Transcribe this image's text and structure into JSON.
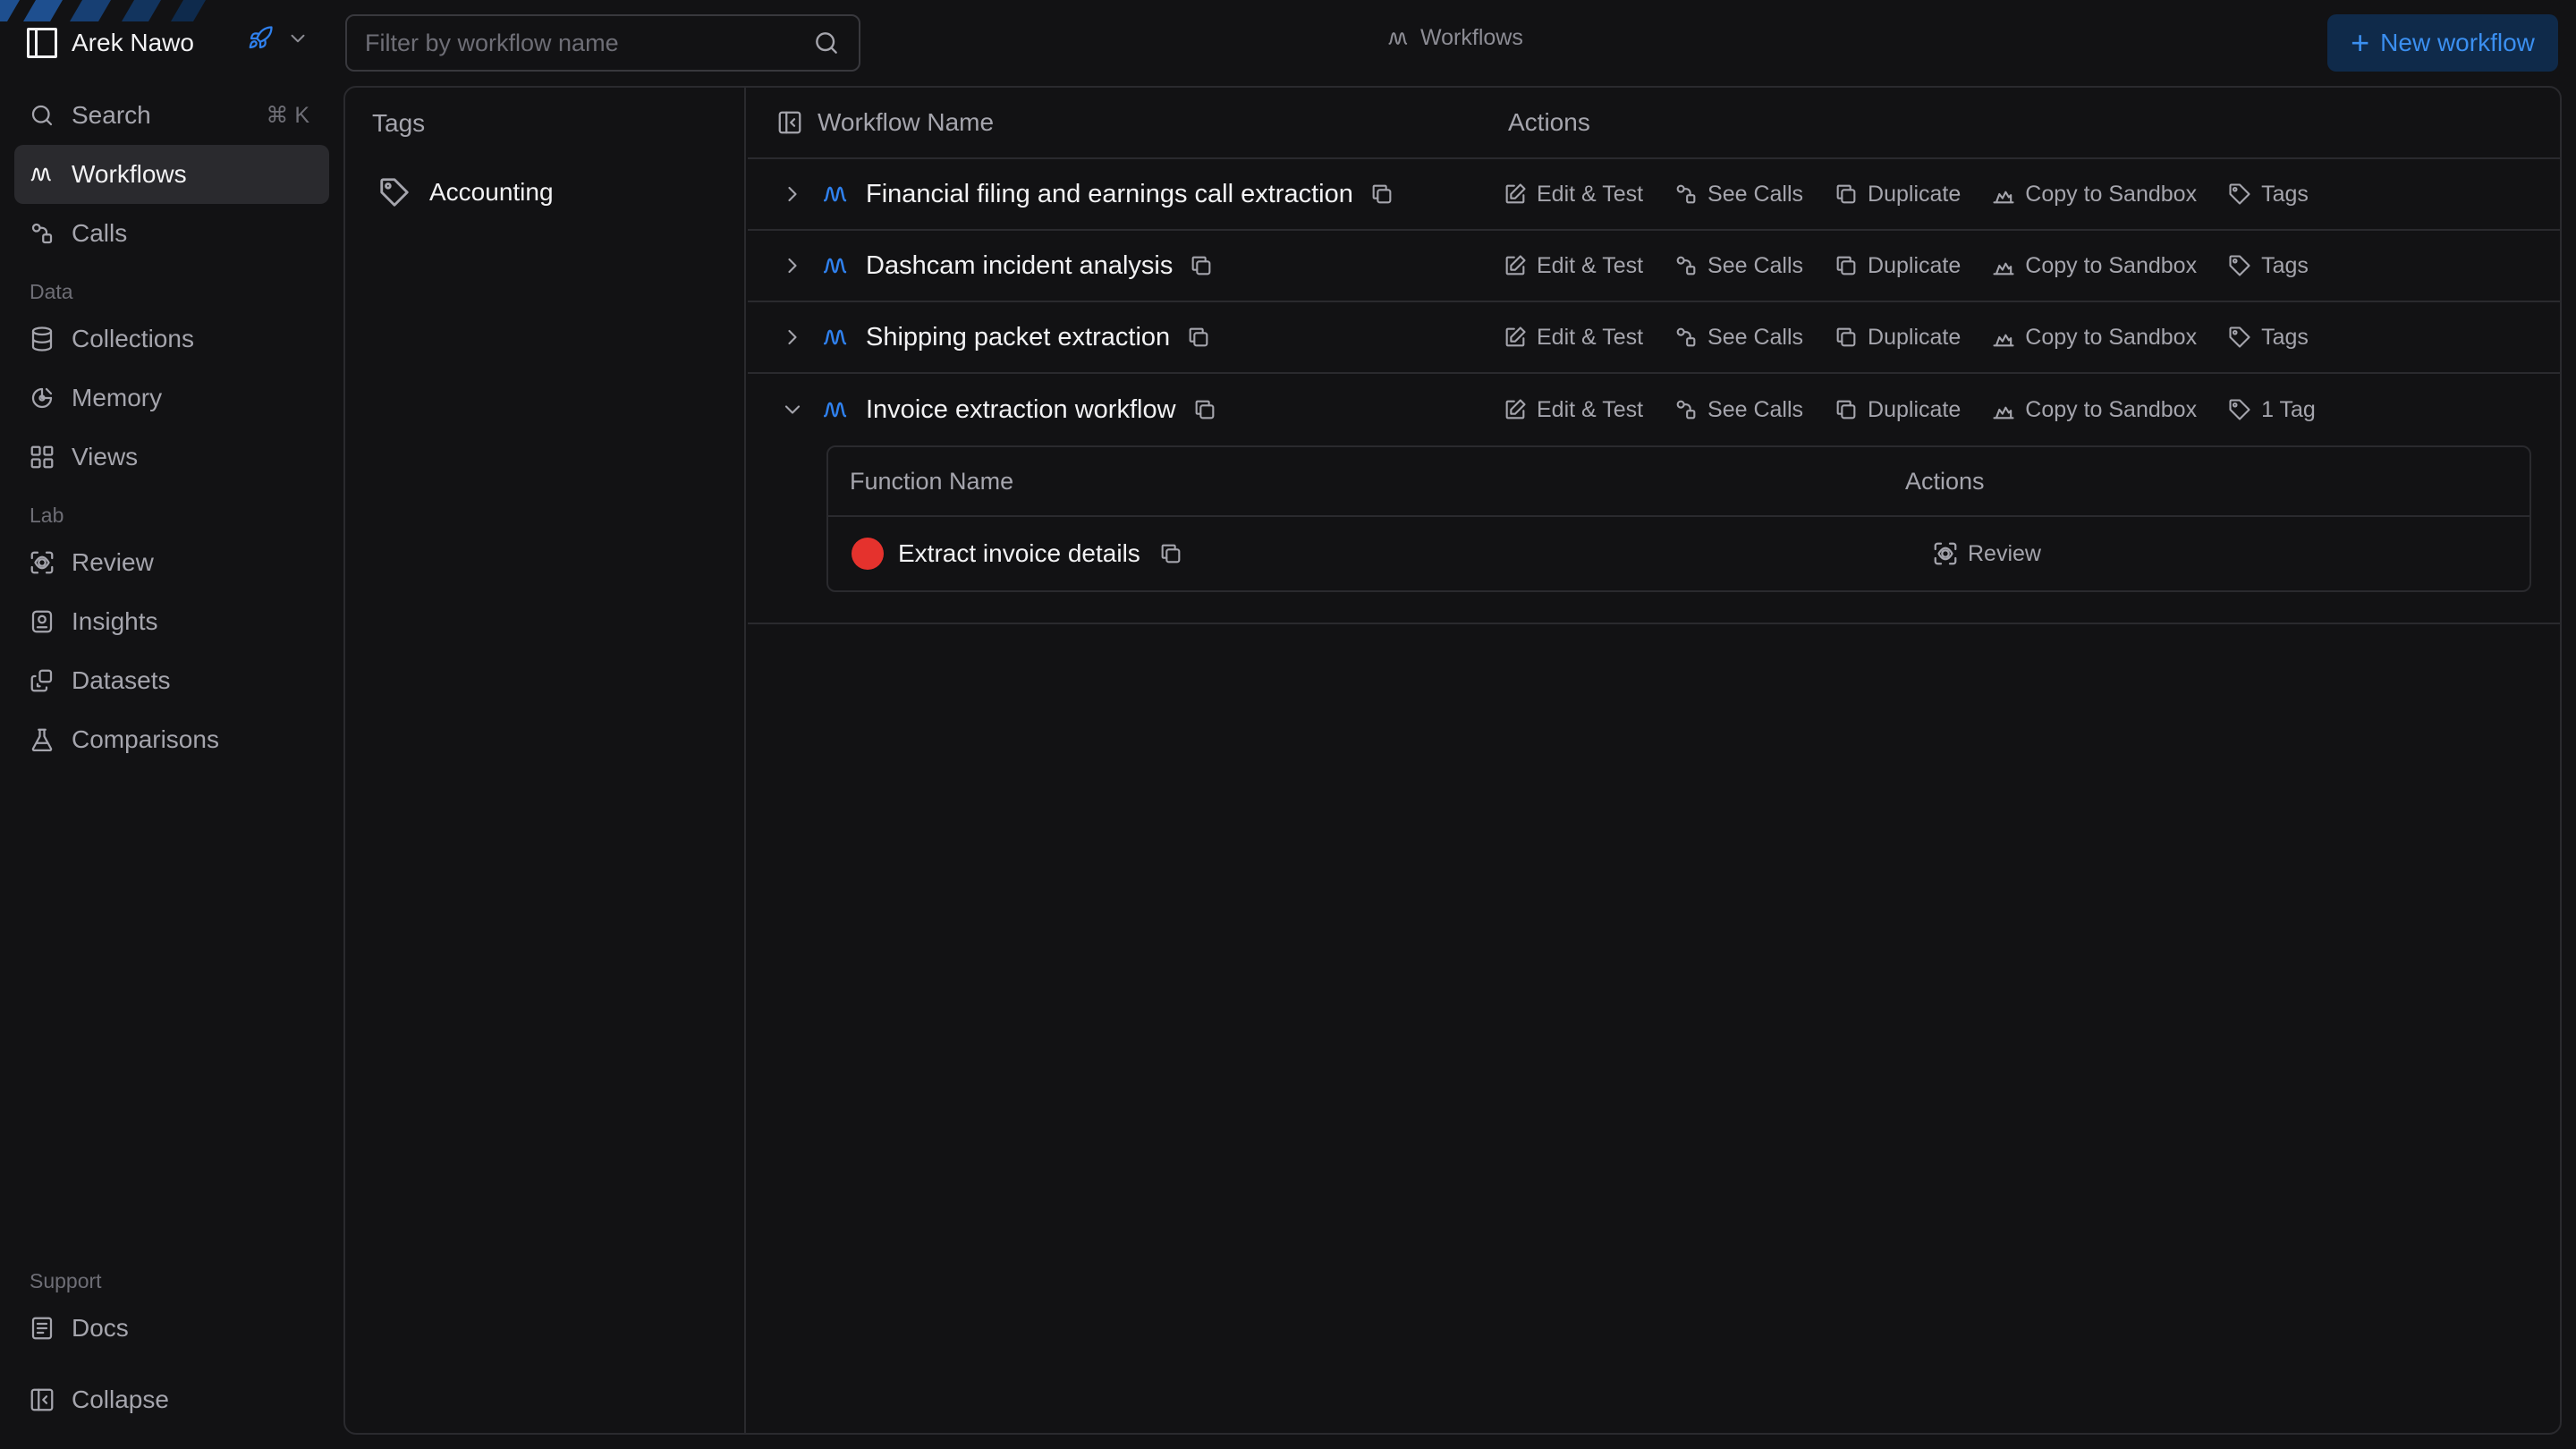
{
  "org": {
    "name": "Arek Nawo"
  },
  "sidebar": {
    "search": {
      "label": "Search",
      "shortcut": "⌘ K"
    },
    "items_top": [
      {
        "label": "Workflows",
        "icon": "workflow-icon",
        "active": true
      },
      {
        "label": "Calls",
        "icon": "calls-icon"
      }
    ],
    "section_data": "Data",
    "items_data": [
      {
        "label": "Collections",
        "icon": "database-icon"
      },
      {
        "label": "Memory",
        "icon": "memory-icon"
      },
      {
        "label": "Views",
        "icon": "grid-icon"
      }
    ],
    "section_lab": "Lab",
    "items_lab": [
      {
        "label": "Review",
        "icon": "review-icon"
      },
      {
        "label": "Insights",
        "icon": "insights-icon"
      },
      {
        "label": "Datasets",
        "icon": "datasets-icon"
      },
      {
        "label": "Comparisons",
        "icon": "flask-icon"
      }
    ],
    "section_support": "Support",
    "docs": "Docs",
    "collapse": "Collapse"
  },
  "topbar": {
    "search_placeholder": "Filter by workflow name",
    "breadcrumb": "Workflows",
    "new_workflow": "New workflow"
  },
  "tags_panel": {
    "title": "Tags",
    "items": [
      "Accounting"
    ]
  },
  "table": {
    "col_name": "Workflow Name",
    "col_actions": "Actions",
    "action_labels": {
      "edit": "Edit & Test",
      "calls": "See Calls",
      "duplicate": "Duplicate",
      "sandbox": "Copy to Sandbox"
    },
    "rows": [
      {
        "name": "Financial filing and earnings call extraction",
        "tags": "Tags",
        "expanded": false
      },
      {
        "name": "Dashcam incident analysis",
        "tags": "Tags",
        "expanded": false
      },
      {
        "name": "Shipping packet extraction",
        "tags": "Tags",
        "expanded": false
      },
      {
        "name": "Invoice extraction workflow",
        "tags": "1 Tag",
        "expanded": true
      }
    ],
    "functions": {
      "col_name": "Function Name",
      "col_actions": "Actions",
      "rows": [
        {
          "name": "Extract invoice details",
          "status_color": "#e5322d",
          "action": "Review"
        }
      ]
    }
  },
  "colors": {
    "accent": "#2f80ed",
    "background": "#121214",
    "active_nav": "#2a2a2e"
  }
}
